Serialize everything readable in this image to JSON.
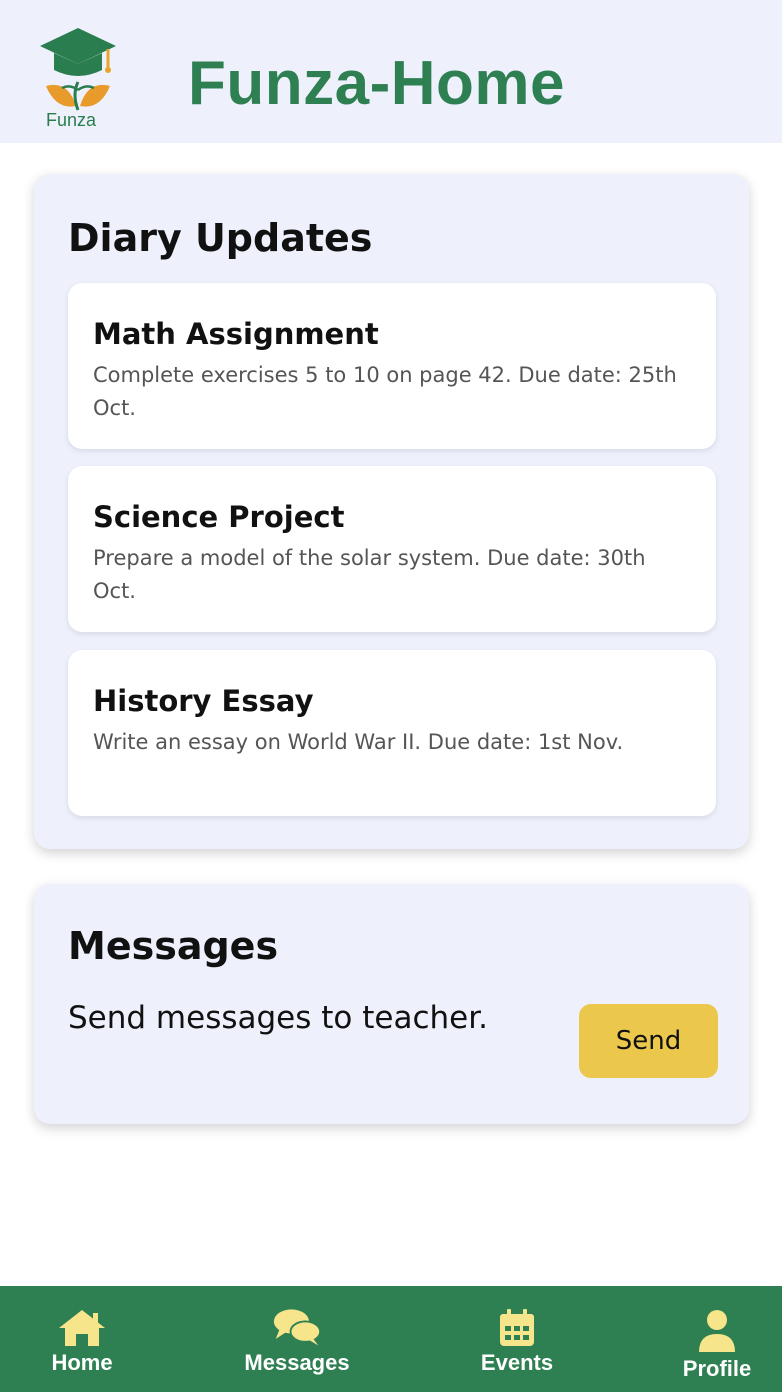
{
  "header": {
    "logo_text": "Funza",
    "title": "Funza-Home"
  },
  "diary": {
    "title": "Diary Updates",
    "entries": [
      {
        "title": "Math Assignment",
        "description": "Complete exercises 5 to 10 on page 42. Due date: 25th Oct."
      },
      {
        "title": "Science Project",
        "description": "Prepare a model of the solar system. Due date: 30th Oct."
      },
      {
        "title": "History Essay",
        "description": "Write an essay on World War II. Due date: 1st Nov."
      }
    ]
  },
  "messages": {
    "title": "Messages",
    "text": "Send messages to teacher.",
    "send_label": "Send"
  },
  "nav": {
    "items": [
      {
        "label": "Home",
        "icon": "home-icon"
      },
      {
        "label": "Messages",
        "icon": "chat-bubbles-icon"
      },
      {
        "label": "Events",
        "icon": "calendar-icon"
      },
      {
        "label": "Profile",
        "icon": "user-icon"
      }
    ]
  },
  "colors": {
    "brand_green": "#2e8052",
    "accent_yellow": "#ebc84c",
    "panel_bg": "#eef1fc",
    "nav_icon_yellow": "#f6e58a",
    "logo_orange": "#e89a2a"
  }
}
